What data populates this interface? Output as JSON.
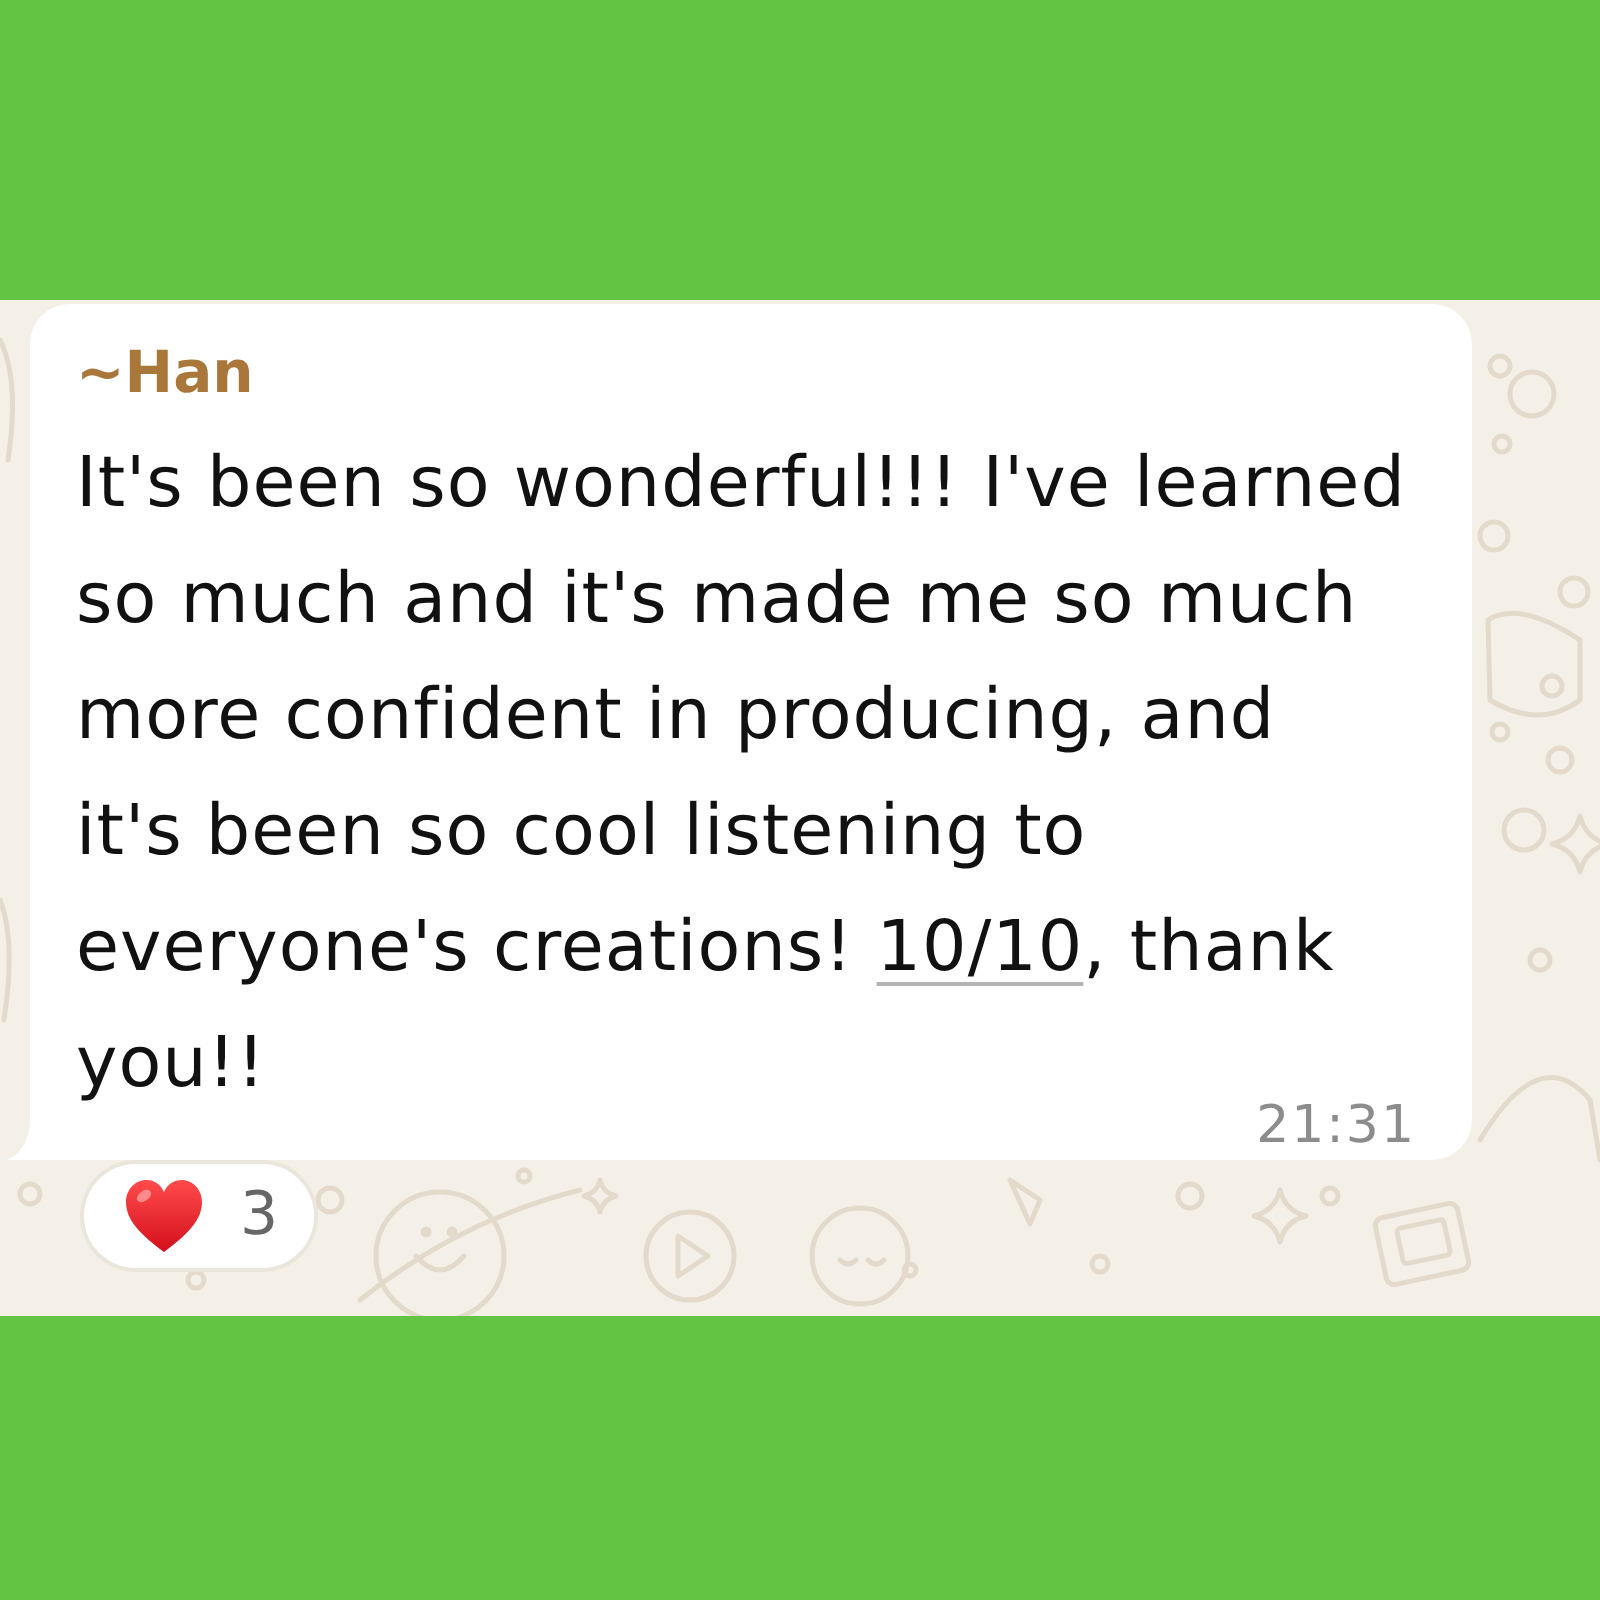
{
  "message": {
    "sender": "~Han",
    "lines": [
      [
        {
          "kind": "text",
          "text": "It's been so wonderful!!! I've learned"
        }
      ],
      [
        {
          "kind": "text",
          "text": "so much and it's made me so much"
        }
      ],
      [
        {
          "kind": "text",
          "text": "more confident in producing, and"
        }
      ],
      [
        {
          "kind": "text",
          "text": "it's been so cool listening to"
        }
      ],
      [
        {
          "kind": "text",
          "text": "everyone's creations! "
        },
        {
          "kind": "link",
          "text": "10/10"
        },
        {
          "kind": "text",
          "text": ", thank"
        }
      ],
      [
        {
          "kind": "text",
          "text": "you!!"
        }
      ]
    ],
    "time": "21:31"
  },
  "reactions": [
    {
      "count": "3"
    }
  ]
}
